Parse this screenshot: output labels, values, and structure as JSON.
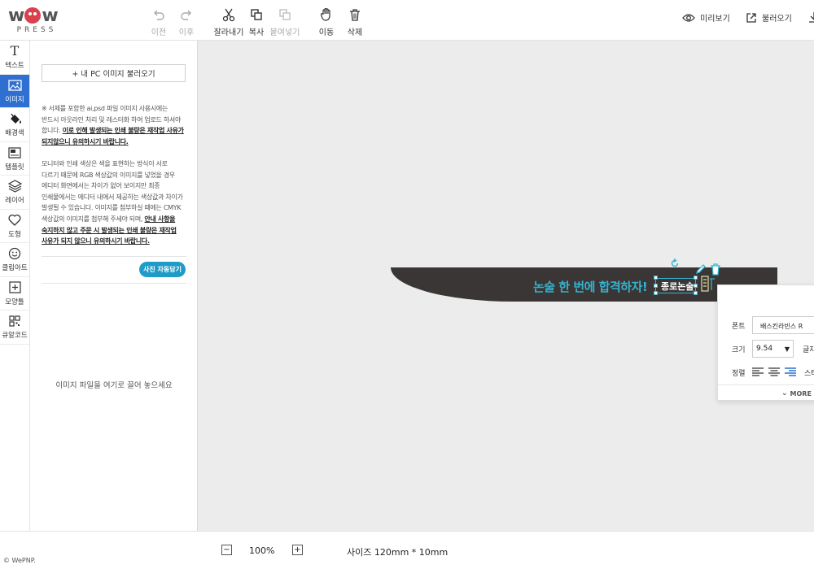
{
  "logo": {
    "word": "wow",
    "sub": "PRESS"
  },
  "toolbar": {
    "undo": "이전",
    "redo": "이후",
    "cut": "잘라내기",
    "copy": "복사",
    "paste": "붙여넣기",
    "move": "이동",
    "delete": "삭제",
    "preview": "미리보기",
    "load": "불러오기"
  },
  "rail": [
    {
      "label": "텍스트",
      "icon": "text-icon"
    },
    {
      "label": "이미지",
      "icon": "image-icon",
      "active": true
    },
    {
      "label": "배경색",
      "icon": "paint-bucket-icon"
    },
    {
      "label": "템플릿",
      "icon": "template-icon"
    },
    {
      "label": "레이어",
      "icon": "layers-icon"
    },
    {
      "label": "도형",
      "icon": "heart-icon"
    },
    {
      "label": "클립아트",
      "icon": "smiley-icon"
    },
    {
      "label": "모양틀",
      "icon": "frame-icon"
    },
    {
      "label": "큐알코드",
      "icon": "qr-code-icon"
    }
  ],
  "panel": {
    "load_button": "+ 내 PC 이미지 불러오기",
    "notice1_plain": "※ 서체를 포함한 ai,psd 파일 이미지 사용시에는 반드시 아웃라인 처리 및 레스터화 하여 업로드 하셔야 합니다. ",
    "notice1_bold": "이로 인해 발생되는 인쇄 불량은 재작업 사유가 되지않으니 유의하시기 바랍니다.",
    "notice2_plain": "모니터와 인쇄 색상은 색을 표현하는 방식이 서로 다르기 때문에 RGB 색상값의 이미지를 넣었을 경우 에디터 화면에서는 차이가 없어 보이지만 최종 인쇄물에서는 에디터 내에서 제공하는 색상값과 차이가 발생될 수 있습니다. 이미지를 첨부하실 때에는 CMYK 색상값의 이미지를 첨부해 주세야 되며, ",
    "notice2_bold": "안내 사항을 숙지하지 않고 주문 시 발생되는 인쇄 불량은 재작업 사유가 되지 않으니 유의하시기 바랍니다.",
    "auto_button": "사진 자동담기",
    "drop_hint": "이미지 파일을 여기로 끌어 놓으세요"
  },
  "canvas": {
    "main_text": "논술 한 번에 합격하자!",
    "selected_text": "종로논술"
  },
  "popup": {
    "font_label": "폰트",
    "font_value": "배스킨라빈스 R",
    "size_label": "크기",
    "size_value": "9.54",
    "spacing_label": "글자",
    "align_label": "정렬",
    "style_label": "스타",
    "more": "MORE"
  },
  "bottom": {
    "zoom": "100%",
    "size_info": "사이즈 120mm * 10mm",
    "copyright": "© WePNP."
  },
  "colors": {
    "accent": "#2f6fd1",
    "teal": "#1e9cc7",
    "brand_red": "#d9414f",
    "canvas_shape": "#3a3636",
    "canvas_text": "#35b3cf"
  }
}
